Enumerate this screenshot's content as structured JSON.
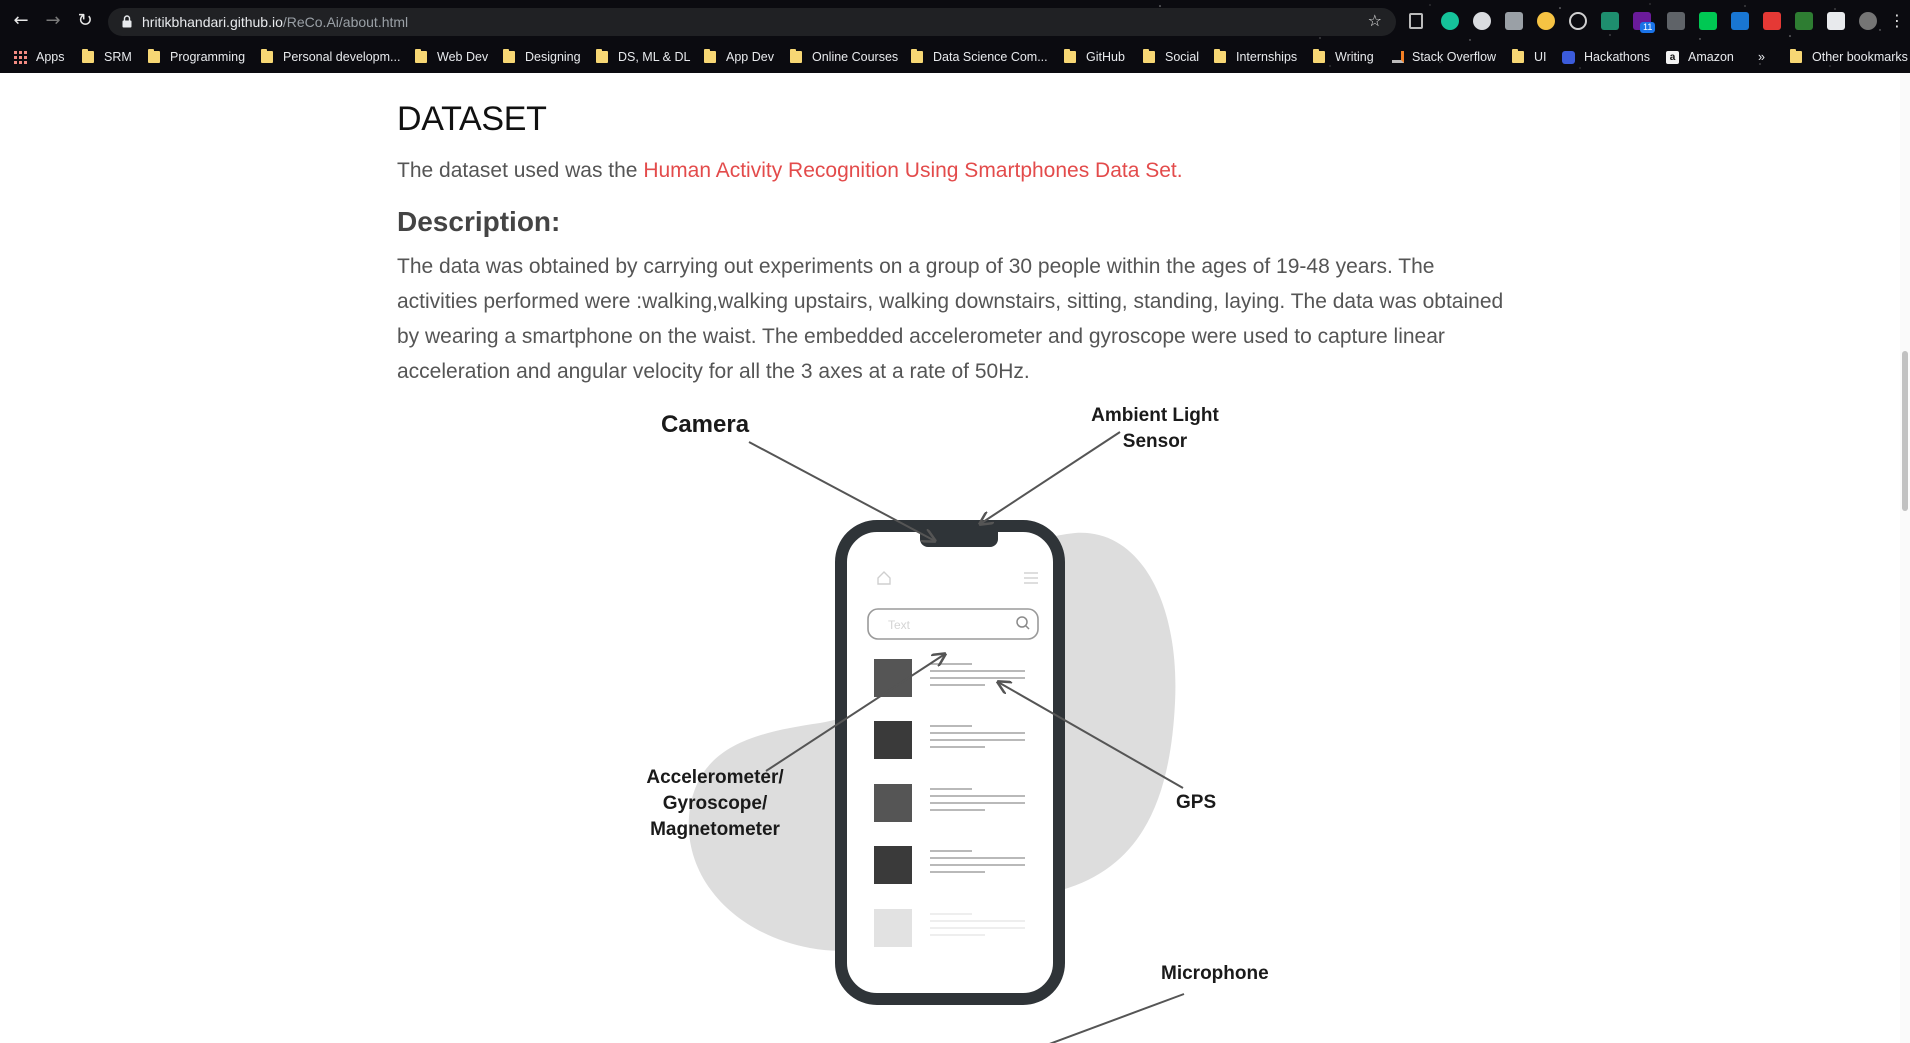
{
  "browser": {
    "url_host": "hritikbhandari.github.io",
    "url_path": "/ReCo.Ai/about.html",
    "bookmarks": [
      "Apps",
      "SRM",
      "Programming",
      "Personal developm...",
      "Web Dev",
      "Designing",
      "DS, ML & DL",
      "App Dev",
      "Online Courses",
      "Data Science Com...",
      "GitHub",
      "Social",
      "Internships",
      "Writing",
      "Stack Overflow",
      "UI",
      "Hackathons",
      "Amazon",
      "»",
      "Other bookmarks"
    ],
    "extension_badge": "11"
  },
  "page": {
    "heading": "DATASET",
    "intro_text": "The dataset used was the ",
    "intro_link": "Human Activity Recognition Using Smartphones Data Set.",
    "subheading": "Description:",
    "description": "The data was obtained by carrying out experiments on a group of 30 people within the ages of 19-48 years. The activities performed were :walking,walking upstairs, walking downstairs, sitting, standing, laying. The data was obtained by wearing a smartphone on the waist. The embedded accelerometer and gyroscope were used to capture linear acceleration and angular velocity for all the 3 axes at a rate of 50Hz."
  },
  "figure": {
    "label_camera": "Camera",
    "label_ambient_1": "Ambient Light",
    "label_ambient_2": "Sensor",
    "label_accel_1": "Accelerometer/",
    "label_accel_2": "Gyroscope/",
    "label_accel_3": "Magnetometer",
    "label_gps": "GPS",
    "label_microphone": "Microphone",
    "search_placeholder": "Text"
  },
  "colors": {
    "link": "#e34b4b",
    "phone_frame": "#2f3438",
    "blob": "#dddddd"
  }
}
